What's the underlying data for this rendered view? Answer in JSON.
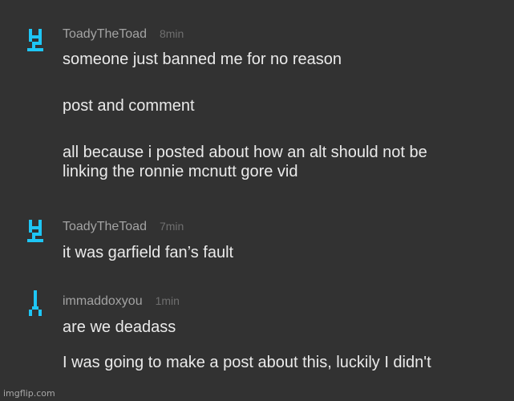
{
  "colors": {
    "background": "#323232",
    "avatar": "#1ec6f5",
    "username": "#a3a3a3",
    "timestamp": "#6f6f6f",
    "text": "#eaeaea"
  },
  "comments": [
    {
      "username": "ToadyTheToad",
      "time": "8min",
      "avatar_icon": "pixel-avatar-icon",
      "paragraphs": [
        "someone just banned me for no reason",
        "post and comment",
        "all because i posted about how an alt should not be\nlinking the ronnie mcnutt gore vid"
      ]
    },
    {
      "username": "ToadyTheToad",
      "time": "7min",
      "avatar_icon": "pixel-avatar-icon",
      "paragraphs": [
        "it was garfield fan’s fault"
      ]
    },
    {
      "username": "immaddoxyou",
      "time": "1min",
      "avatar_icon": "pixel-avatar-icon",
      "paragraphs": [
        "are we deadass",
        "I was going to make a post about this, luckily I didn't"
      ]
    }
  ],
  "watermark": "imgflip.com"
}
